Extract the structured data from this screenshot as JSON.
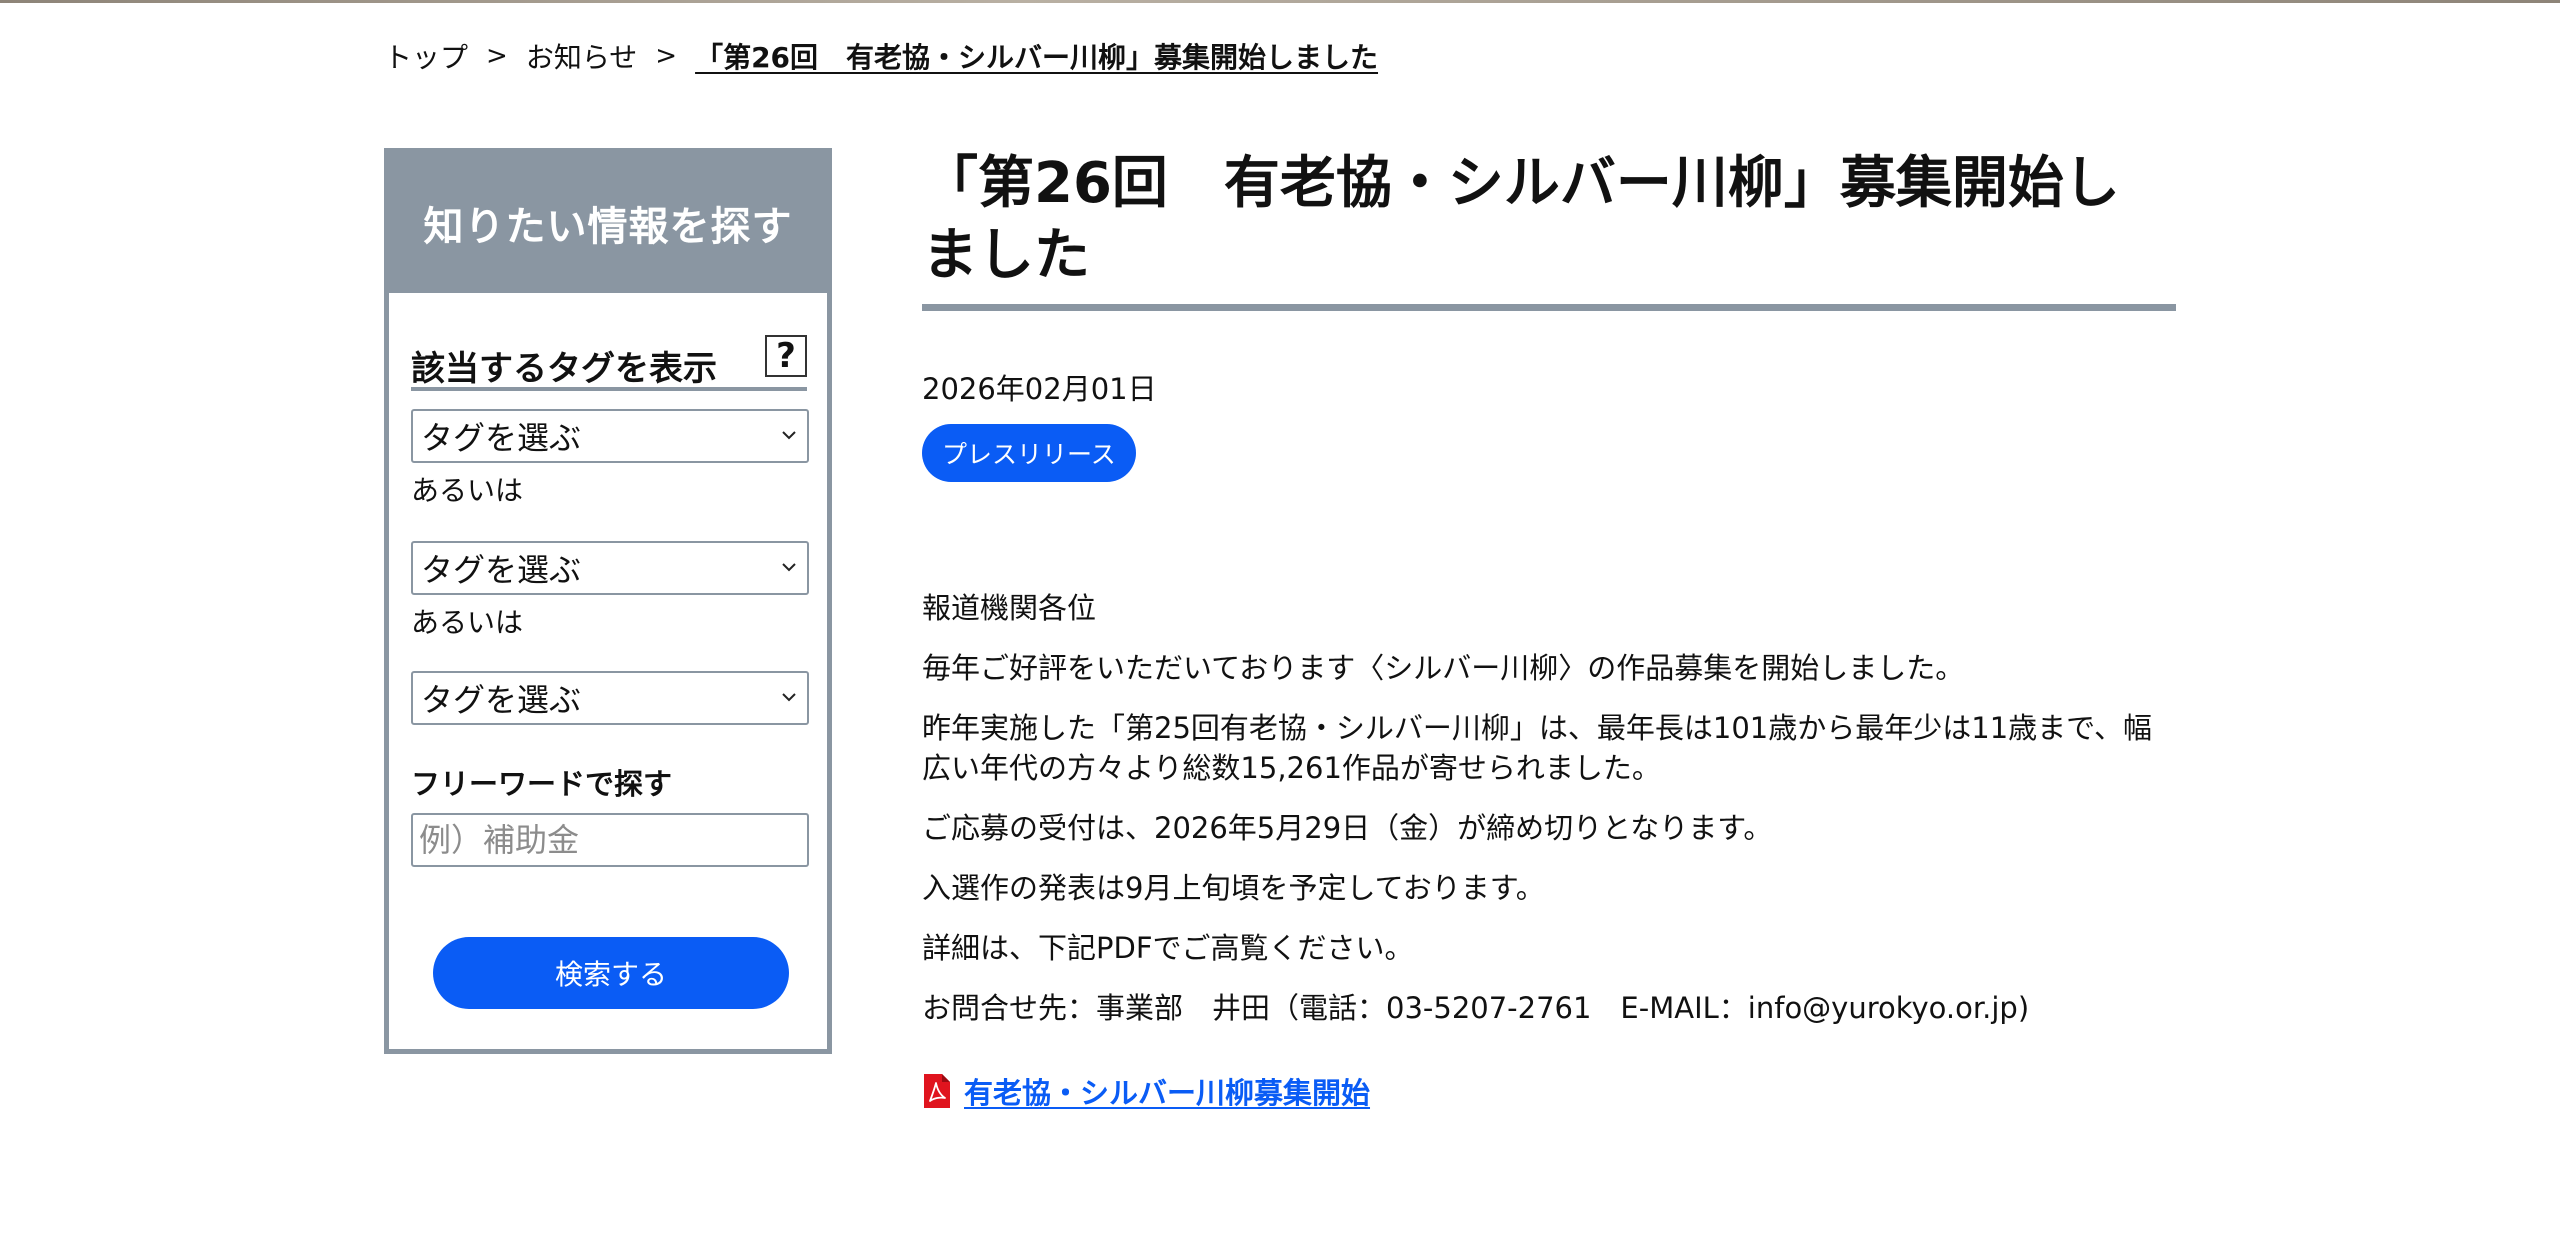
{
  "breadcrumb": {
    "items": [
      "トップ",
      "お知らせ"
    ],
    "separator": ">",
    "current": "「第26回　有老協・シルバー川柳」募集開始しました"
  },
  "sidebar": {
    "header": "知りたい情報を探す",
    "tag_heading": "該当するタグを表示",
    "help": "?",
    "selects": [
      "タグを選ぶ",
      "タグを選ぶ",
      "タグを選ぶ"
    ],
    "or_label": "あるいは",
    "free_word_label": "フリーワードで探す",
    "free_word_placeholder": "例）補助金",
    "search_button": "検索する"
  },
  "article": {
    "title": "「第26回　有老協・シルバー川柳」募集開始しました",
    "date": "2026年02月01日",
    "badge": "プレスリリース",
    "paragraphs": [
      "報道機関各位",
      "毎年ご好評をいただいております〈シルバー川柳〉の作品募集を開始しました。",
      "昨年実施した「第25回有老協・シルバー川柳」は、最年長は101歳から最年少は11歳まで、幅広い年代の方々より総数15,261作品が寄せられました。",
      "ご応募の受付は、2026年5月29日（金）が締め切りとなります。",
      "入選作の発表は9月上旬頃を予定しております。",
      "詳細は、下記PDFでご高覧ください。",
      "お問合せ先：事業部　井田（電話：03-5207-2761　E-MAIL：info@yurokyo.or.jp)"
    ],
    "pdf_link": "有老協・シルバー川柳募集開始",
    "pdf_icon": "pdf-icon"
  },
  "colors": {
    "accent": "#0a5cf5",
    "sidebar_gray": "#8a96a2",
    "pdf_red": "#e0141e"
  }
}
